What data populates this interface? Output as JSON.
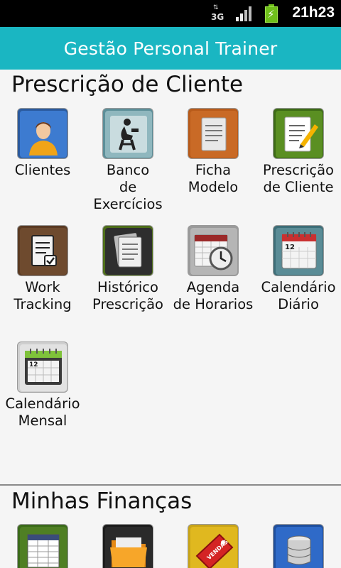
{
  "status_bar": {
    "network_type": "3G",
    "clock": "21h23",
    "icons": [
      "data-arrows-icon",
      "signal-icon",
      "battery-charging-icon"
    ]
  },
  "app_bar": {
    "title": "Gestão Personal Trainer"
  },
  "sections": [
    {
      "title": "Prescrição de Cliente",
      "items": [
        {
          "label": "Clientes",
          "icon": "client-person-icon"
        },
        {
          "label": "Banco de Exercícios",
          "icon": "exercise-bank-icon"
        },
        {
          "label": "Ficha Modelo",
          "icon": "template-sheet-icon"
        },
        {
          "label": "Prescrição de Cliente",
          "icon": "prescription-pencil-icon"
        },
        {
          "label": "Work Tracking",
          "icon": "checklist-icon"
        },
        {
          "label": "Histórico Prescrição",
          "icon": "history-documents-icon"
        },
        {
          "label": "Agenda de Horarios",
          "icon": "calendar-clock-icon"
        },
        {
          "label": "Calendário Diário",
          "icon": "daily-calendar-icon"
        },
        {
          "label": "Calendário Mensal",
          "icon": "monthly-calendar-icon"
        }
      ]
    },
    {
      "title": "Minhas Finanças",
      "items": [
        {
          "label": "",
          "icon": "spreadsheet-icon"
        },
        {
          "label": "",
          "icon": "folder-icon"
        },
        {
          "label": "VENDAS",
          "icon": "sales-tag-icon"
        },
        {
          "label": "",
          "icon": "database-icon"
        }
      ]
    }
  ],
  "calendar_day_number": "12"
}
